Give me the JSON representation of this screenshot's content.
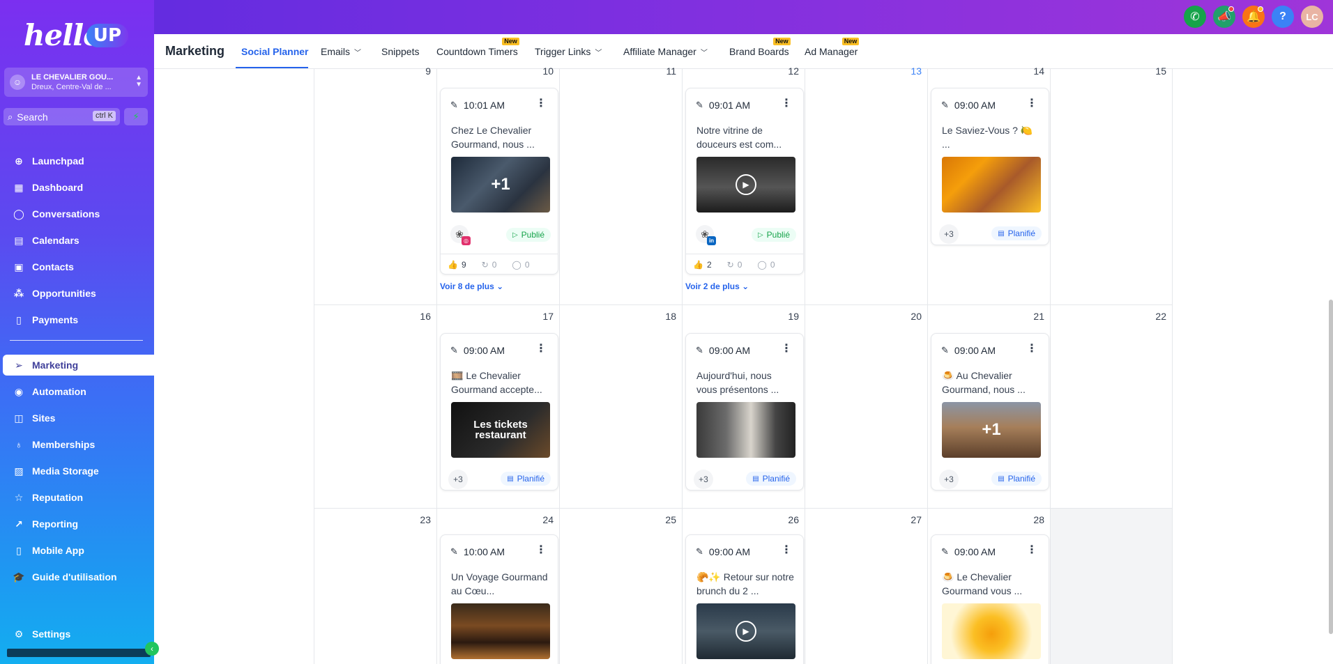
{
  "topbar": {
    "icons": [
      "phone-icon",
      "megaphone-icon",
      "bell-icon",
      "help-icon"
    ],
    "help_glyph": "?",
    "avatar_initials": "LC"
  },
  "sidebar": {
    "logo_text": "hello!",
    "logo_badge": "UP",
    "account": {
      "name": "LE CHEVALIER GOU...",
      "location": "Dreux, Centre-Val de ..."
    },
    "search": {
      "placeholder": "Search",
      "shortcut": "ctrl K"
    },
    "items": [
      {
        "label": "Launchpad",
        "icon": "launchpad-icon"
      },
      {
        "label": "Dashboard",
        "icon": "dashboard-icon"
      },
      {
        "label": "Conversations",
        "icon": "chat-icon"
      },
      {
        "label": "Calendars",
        "icon": "calendar-icon"
      },
      {
        "label": "Contacts",
        "icon": "contacts-icon"
      },
      {
        "label": "Opportunities",
        "icon": "opportunities-icon"
      },
      {
        "label": "Payments",
        "icon": "payments-icon"
      },
      {
        "label": "Marketing",
        "icon": "send-icon"
      },
      {
        "label": "Automation",
        "icon": "automation-icon"
      },
      {
        "label": "Sites",
        "icon": "sites-icon"
      },
      {
        "label": "Memberships",
        "icon": "membership-icon"
      },
      {
        "label": "Media Storage",
        "icon": "image-icon"
      },
      {
        "label": "Reputation",
        "icon": "star-icon"
      },
      {
        "label": "Reporting",
        "icon": "trend-icon"
      },
      {
        "label": "Mobile App",
        "icon": "mobile-icon"
      },
      {
        "label": "Guide d'utilisation",
        "icon": "graduation-icon"
      },
      {
        "label": "Settings",
        "icon": "gear-icon"
      }
    ]
  },
  "subnav": {
    "title": "Marketing",
    "tabs": [
      {
        "label": "Social Planner",
        "active": true
      },
      {
        "label": "Emails",
        "dropdown": true
      },
      {
        "label": "Snippets"
      },
      {
        "label": "Countdown Timers",
        "badge": "New"
      },
      {
        "label": "Trigger Links",
        "dropdown": true
      },
      {
        "label": "Affiliate Manager",
        "dropdown": true
      },
      {
        "label": "Brand Boards",
        "badge": "New"
      },
      {
        "label": "Ad Manager",
        "badge": "New"
      }
    ]
  },
  "calendar": {
    "days": [
      "9",
      "10",
      "11",
      "12",
      "13",
      "14",
      "15",
      "16",
      "17",
      "18",
      "19",
      "20",
      "21",
      "22",
      "23",
      "24",
      "25",
      "26",
      "27",
      "28"
    ],
    "today": "13",
    "see_more": [
      "Voir 8 de plus",
      "Voir 2 de plus"
    ],
    "posts": [
      {
        "time": "10:01 AM",
        "text": "Chez Le Chevalier Gourmand, nous ...",
        "overlay": "+1",
        "network": "instagram",
        "network_glyph": "◎",
        "status": "Publié",
        "likes": "9",
        "shares": "0",
        "comments": "0"
      },
      {
        "time": "09:01 AM",
        "text": "Notre vitrine de douceurs est com...",
        "overlay": "",
        "network": "linkedin",
        "network_glyph": "in",
        "status": "Publié",
        "likes": "2",
        "shares": "0",
        "comments": "0"
      },
      {
        "time": "09:00 AM",
        "text": "Le Saviez-Vous ? 🍋 ...",
        "overlay": "",
        "count": "+3",
        "status": "Planifié"
      },
      {
        "time": "09:00 AM",
        "text": "🎞️ Le Chevalier Gourmand accepte...",
        "overlay": "Les tickets restaurant",
        "count": "+3",
        "status": "Planifié"
      },
      {
        "time": "09:00 AM",
        "text": "Aujourd'hui, nous vous présentons ...",
        "overlay": "",
        "count": "+3",
        "status": "Planifié"
      },
      {
        "time": "09:00 AM",
        "text": "🍮 Au Chevalier Gourmand, nous ...",
        "overlay": "+1",
        "count": "+3",
        "status": "Planifié"
      },
      {
        "time": "10:00 AM",
        "text": "Un Voyage Gourmand au Cœu...",
        "overlay": ""
      },
      {
        "time": "09:00 AM",
        "text": "🥐✨ Retour sur notre brunch du 2 ...",
        "overlay": ""
      },
      {
        "time": "09:00 AM",
        "text": "🍮 Le Chevalier Gourmand vous ...",
        "overlay": ""
      }
    ]
  },
  "colors": {
    "accent": "#2563eb",
    "published": "#16a34a",
    "today": "#3b82f6"
  }
}
